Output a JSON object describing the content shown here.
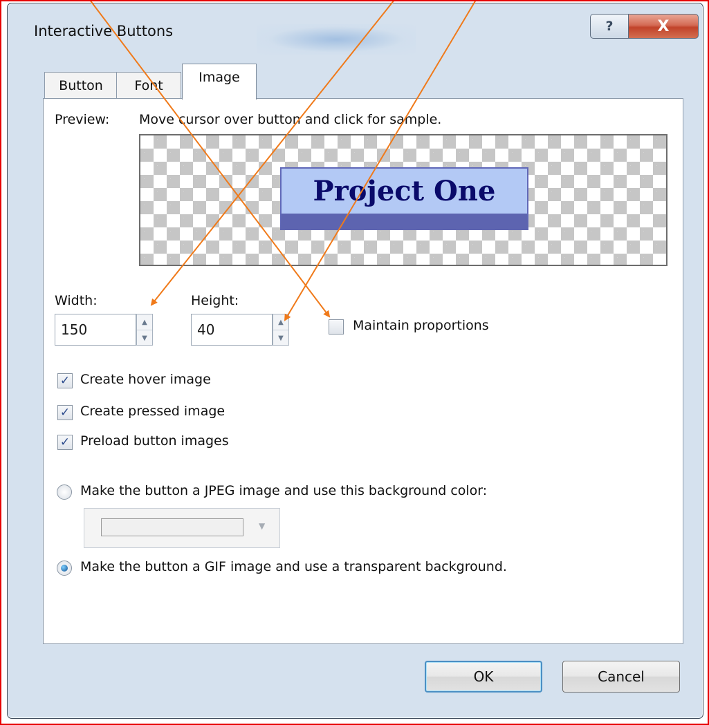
{
  "window": {
    "title": "Interactive Buttons",
    "help_glyph": "?",
    "close_glyph": "X"
  },
  "tabs": [
    {
      "label": "Button",
      "selected": false
    },
    {
      "label": "Font",
      "selected": false
    },
    {
      "label": "Image",
      "selected": true
    }
  ],
  "preview": {
    "label": "Preview:",
    "hint": "Move cursor over button and click for sample.",
    "sample_text": "Project One"
  },
  "size": {
    "width_label": "Width:",
    "width_value": "150",
    "height_label": "Height:",
    "height_value": "40",
    "maintain_proportions_label": "Maintain proportions",
    "maintain_proportions_checked": false
  },
  "options": [
    {
      "label": "Create hover image",
      "checked": true
    },
    {
      "label": "Create pressed image",
      "checked": true
    },
    {
      "label": "Preload button images",
      "checked": true
    }
  ],
  "format": {
    "jpeg_label": "Make the button a JPEG image and use this background color:",
    "gif_label": "Make the button a GIF image and use a transparent background.",
    "selected": "gif"
  },
  "buttons": {
    "ok": "OK",
    "cancel": "Cancel"
  },
  "colors": {
    "annotation_arrow": "#f07a1a",
    "frame_border": "#e60000",
    "sample_button_face": "#b3c9f5",
    "sample_button_text": "#0a0a6a"
  },
  "check_glyph": "✓",
  "spin_up_glyph": "▲",
  "spin_down_glyph": "▼",
  "combo_arrow_glyph": "▼"
}
